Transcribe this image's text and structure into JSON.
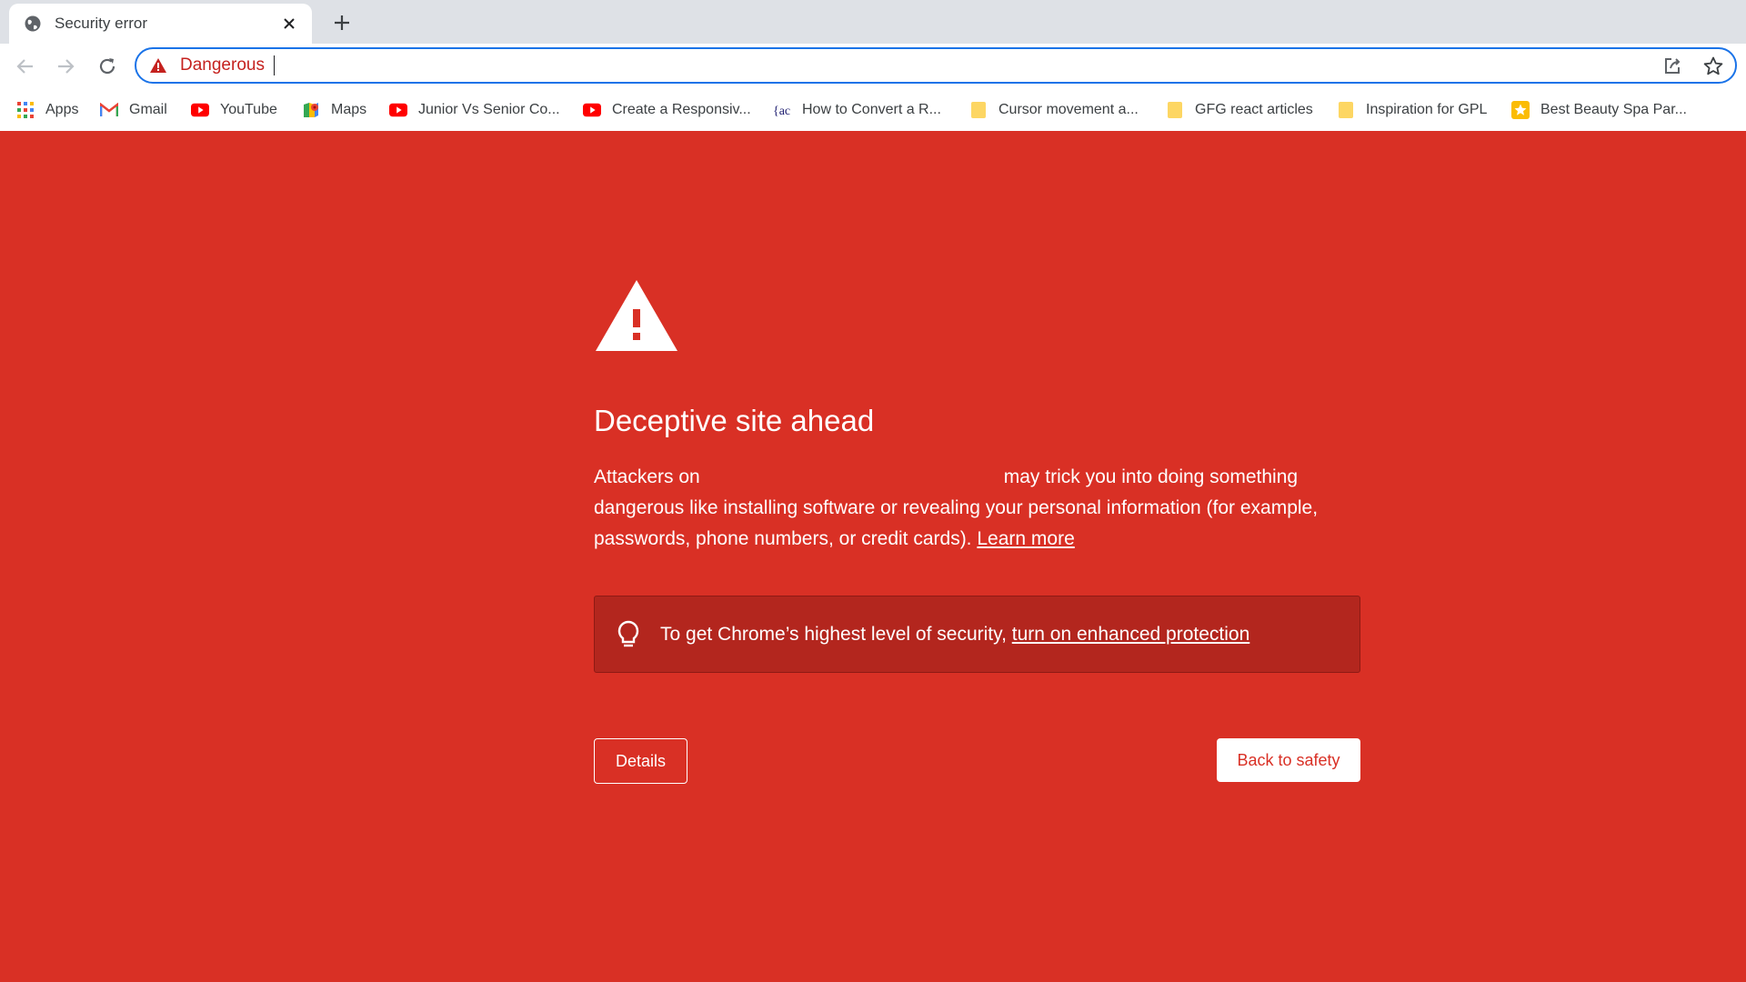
{
  "browser": {
    "tab": {
      "title": "Security error",
      "favicon": "globe-icon"
    },
    "new_tab_icon": "plus-icon",
    "omnibox": {
      "security_label": "Dangerous",
      "security_icon": "warning-triangle-icon",
      "text": ""
    },
    "accent_color": "#1a73e8",
    "danger_color": "#c5221f"
  },
  "bookmarks": [
    {
      "label": "Apps",
      "icon": "apps-grid-icon"
    },
    {
      "label": "Gmail",
      "icon": "gmail-icon"
    },
    {
      "label": "YouTube",
      "icon": "youtube-icon"
    },
    {
      "label": "Maps",
      "icon": "maps-icon"
    },
    {
      "label": "Junior Vs Senior Co...",
      "icon": "youtube-icon"
    },
    {
      "label": "Create a Responsiv...",
      "icon": "youtube-icon"
    },
    {
      "label": "How to Convert a R...",
      "icon": "site-icon"
    },
    {
      "label": "Cursor movement a...",
      "icon": "folder-icon"
    },
    {
      "label": "GFG react articles",
      "icon": "folder-icon"
    },
    {
      "label": "Inspiration for GPL",
      "icon": "folder-icon"
    },
    {
      "label": "Best Beauty Spa Par...",
      "icon": "star-favicon-icon"
    }
  ],
  "interstitial": {
    "background_color": "#d93025",
    "heading": "Deceptive site ahead",
    "para_start": "Attackers on",
    "para_rest": "may trick you into doing something dangerous like installing software or revealing your personal information (for example, passwords, phone numbers, or credit cards).",
    "learn_more": "Learn more",
    "enhanced_text": "To get Chrome’s highest level of security,",
    "enhanced_link": "turn on enhanced protection",
    "details_label": "Details",
    "back_label": "Back to safety"
  }
}
